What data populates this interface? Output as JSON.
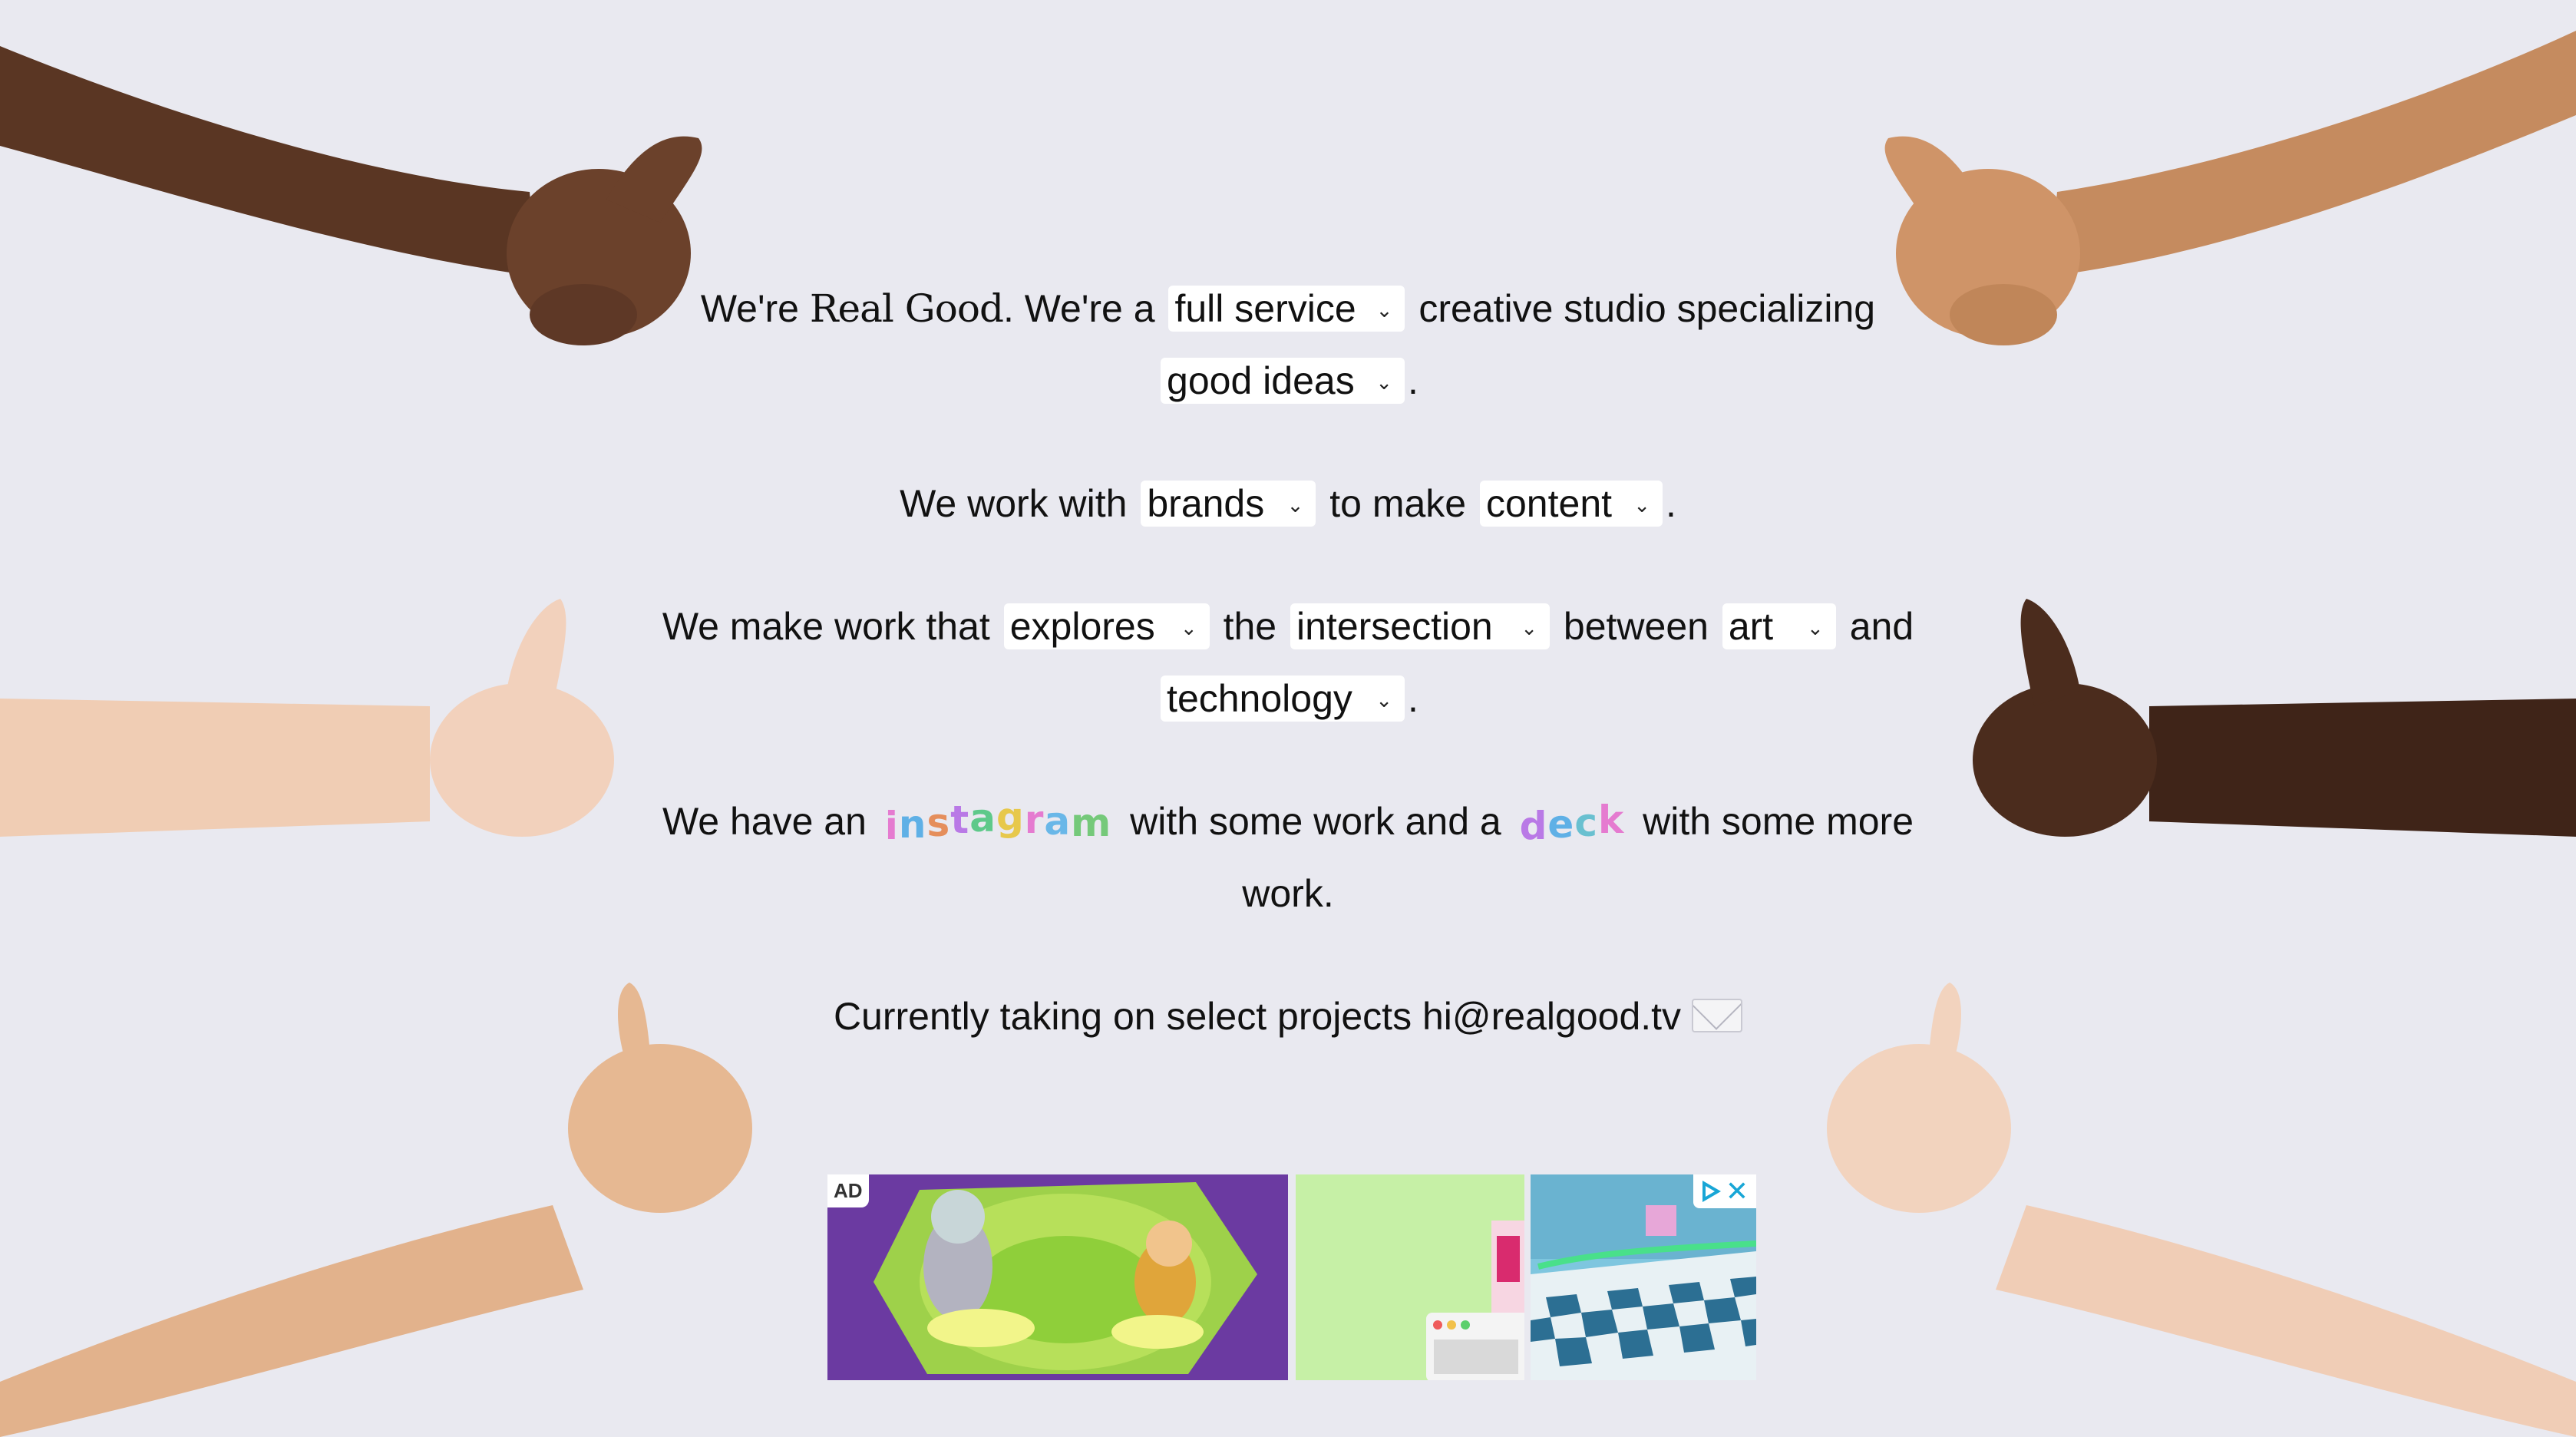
{
  "intro": {
    "text_before_brand": "We're ",
    "brand": "Real Good",
    "text_after_brand": ". We're a ",
    "service_select": "full service",
    "text_after_service": " creative studio specializing",
    "specialty_select": "good ideas",
    "end": "."
  },
  "work_with": {
    "prefix": "We work with ",
    "client_select": "brands",
    "middle": " to make ",
    "output_select": "content",
    "end": "."
  },
  "make_work": {
    "prefix": "We make work that ",
    "verb_select": "explores",
    "the": " the ",
    "noun_select": "intersection",
    "between": " between ",
    "field1_select": "art",
    "and": " and",
    "field2_select": "technology",
    "end": "."
  },
  "links": {
    "prefix": "We have an ",
    "instagram": "instagram",
    "middle": " with some work and a ",
    "deck": "deck",
    "suffix": " with some more work."
  },
  "contact": {
    "text": "Currently taking on select projects ",
    "email": "hi@realgood.tv",
    "icon": "envelope-icon"
  },
  "ad": {
    "badge": "AD",
    "close": "✕"
  },
  "colors": {
    "background": "#e9e9f0",
    "instagram_letters": [
      "#e57bd0",
      "#5fb0e6",
      "#e58e5b",
      "#b979e6",
      "#5ec98a",
      "#e7c84b",
      "#e57bd0",
      "#69b7e8",
      "#75c97a"
    ],
    "deck_letters": [
      "#b979e6",
      "#5fb0e6",
      "#69c0d0",
      "#e57bd0"
    ]
  }
}
